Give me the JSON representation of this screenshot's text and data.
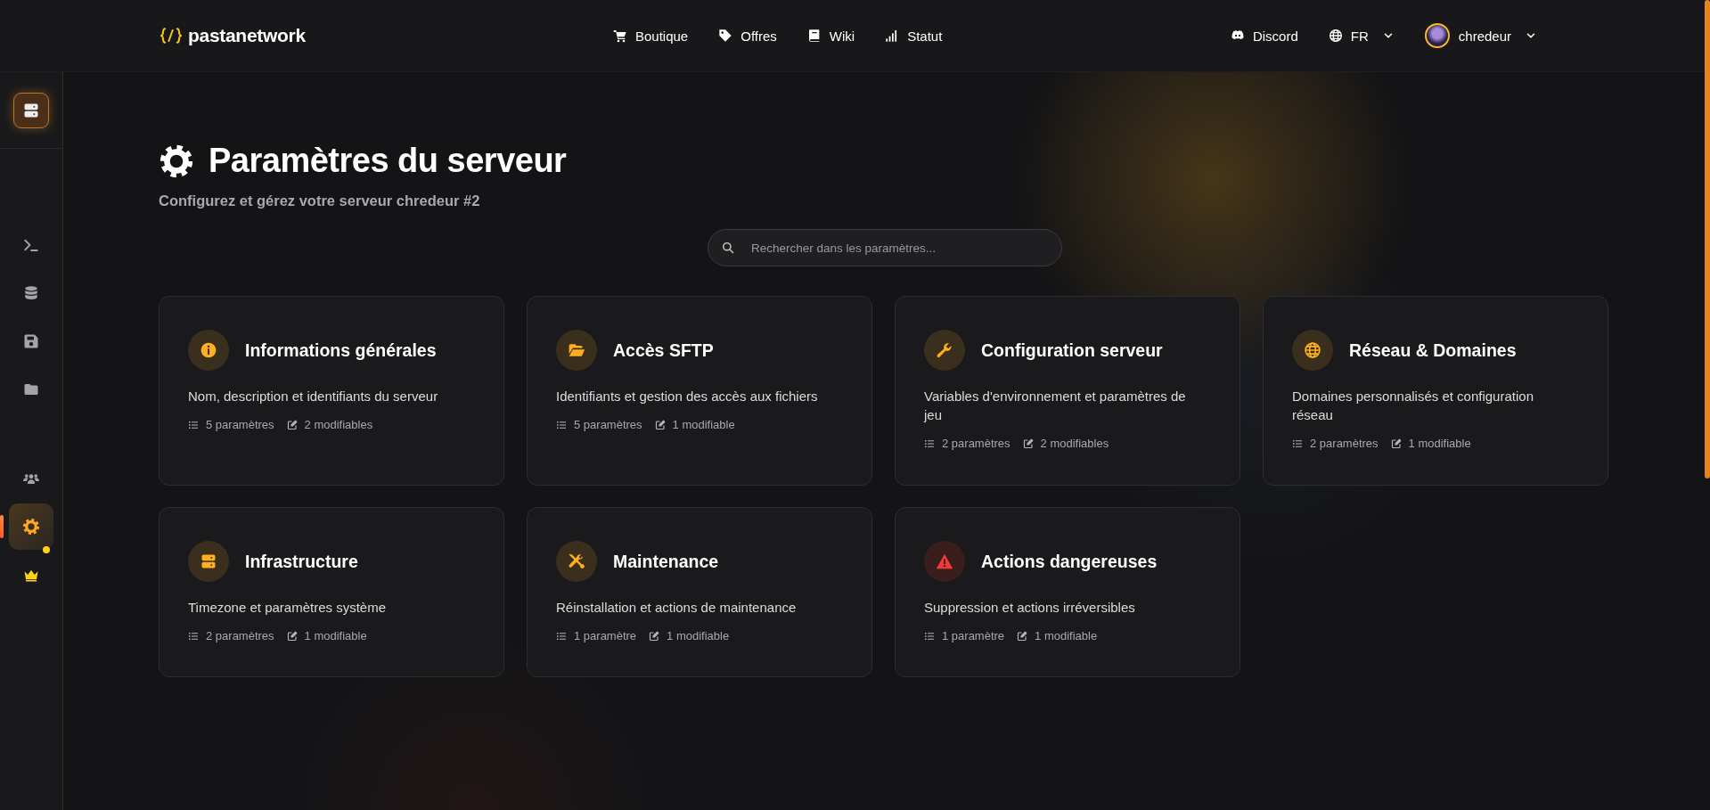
{
  "header": {
    "brand": "pastanetwork",
    "nav": [
      {
        "label": "Boutique"
      },
      {
        "label": "Offres"
      },
      {
        "label": "Wiki"
      },
      {
        "label": "Statut"
      }
    ],
    "discord": "Discord",
    "language": "FR",
    "user": "chredeur"
  },
  "sidebar": {
    "groups": [
      {
        "items": [
          {
            "selected": false,
            "notification": false
          },
          {
            "selected": false,
            "notification": false
          },
          {
            "selected": false,
            "notification": false
          },
          {
            "selected": false,
            "notification": false
          }
        ]
      },
      {
        "items": [
          {
            "selected": false,
            "notification": false
          },
          {
            "selected": true,
            "notification": false
          },
          {
            "selected": false,
            "notification": true
          }
        ]
      }
    ]
  },
  "page": {
    "title": "Paramètres du serveur",
    "subtitle": "Configurez et gérez votre serveur chredeur #2",
    "search": {
      "placeholder": "Rechercher dans les paramètres..."
    },
    "cards": [
      {
        "title": "Informations générales",
        "description": "Nom, description et identifiants du serveur",
        "settings": "5 paramètres",
        "editable": "2 modifiables",
        "danger": false
      },
      {
        "title": "Accès SFTP",
        "description": "Identifiants et gestion des accès aux fichiers",
        "settings": "5 paramètres",
        "editable": "1 modifiable",
        "danger": false
      },
      {
        "title": "Configuration serveur",
        "description": "Variables d'environnement et paramètres de jeu",
        "settings": "2 paramètres",
        "editable": "2 modifiables",
        "danger": false
      },
      {
        "title": "Réseau & Domaines",
        "description": "Domaines personnalisés et configuration réseau",
        "settings": "2 paramètres",
        "editable": "1 modifiable",
        "danger": false
      },
      {
        "title": "Infrastructure",
        "description": "Timezone et paramètres système",
        "settings": "2 paramètres",
        "editable": "1 modifiable",
        "danger": false
      },
      {
        "title": "Maintenance",
        "description": "Réinstallation et actions de maintenance",
        "settings": "1 paramètre",
        "editable": "1 modifiable",
        "danger": false
      },
      {
        "title": "Actions dangereuses",
        "description": "Suppression et actions irréversibles",
        "settings": "1 paramètre",
        "editable": "1 modifiable",
        "danger": true
      }
    ]
  }
}
